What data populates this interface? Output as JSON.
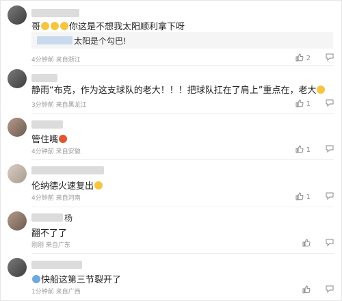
{
  "comments": [
    {
      "text_a": "哥",
      "text_b": "你这是不想我太阳顺利拿下呀",
      "quote_text": "太阳是个勾巴!",
      "meta": "4分钟前 来自浙江",
      "likes": "2"
    },
    {
      "text_a": "静雨“布克，作为这支球队的老大！！！把球队扛在了肩上”重点在，老大",
      "meta": "3分钟前 来自黑龙江",
      "likes": "1"
    },
    {
      "text_a": "管住嘴",
      "meta": "4分钟前 来自安徽",
      "likes": "1"
    },
    {
      "text_a": "伦纳德火速复出",
      "meta": "4分钟前 来自河南",
      "likes": "1"
    },
    {
      "name_tail": "杨",
      "text_a": "翻不了了",
      "meta": "刚刚 来自广东",
      "likes": ""
    },
    {
      "text_a": "快船这第三节裂开了",
      "meta": "1分钟前 来自广西",
      "likes": ""
    }
  ],
  "icons": {
    "like": "thumbs-up-icon",
    "reply": "comment-bubble-icon"
  }
}
